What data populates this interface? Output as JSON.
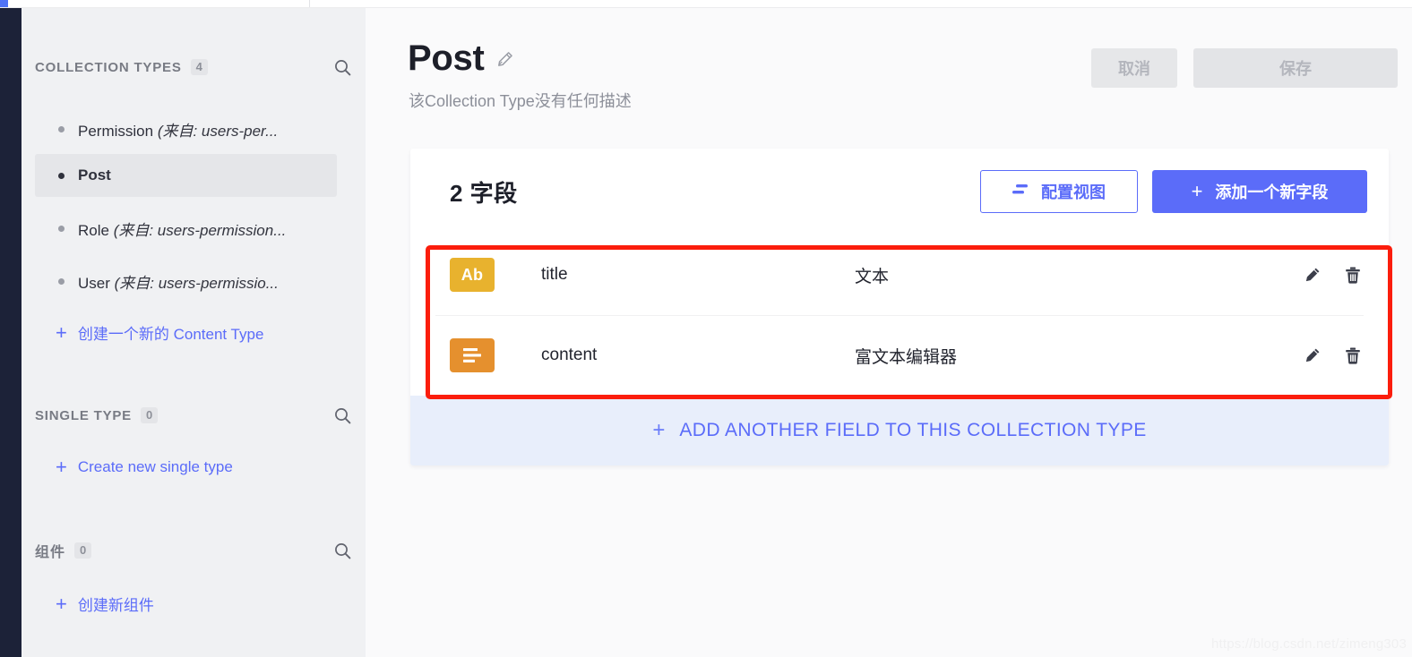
{
  "theme": {
    "accent": "#5b6cf9",
    "rail": "#1c2238",
    "sidebar_bg": "#f0f1f3",
    "main_bg": "#fafafb",
    "card_bg": "#ffffff",
    "footer_bg": "#e8eefb",
    "annotation": "#fb1d0c",
    "text_icon": "#e8b22e",
    "richtext_icon": "#e5902e"
  },
  "sidebar": {
    "sections": [
      {
        "title": "COLLECTION TYPES",
        "count": "4",
        "search_icon": "search-icon",
        "items": [
          {
            "label": "Permission ",
            "suffix": "(来自: users-per...",
            "active": false
          },
          {
            "label": "Post",
            "suffix": "",
            "active": true
          },
          {
            "label": "Role ",
            "suffix": "(来自: users-permission...",
            "active": false
          },
          {
            "label": "User ",
            "suffix": "(来自: users-permissio...",
            "active": false
          }
        ],
        "action": {
          "plus": "+",
          "label": "创建一个新的 Content Type"
        }
      },
      {
        "title": "SINGLE TYPE",
        "count": "0",
        "search_icon": "search-icon",
        "items": [],
        "action": {
          "plus": "+",
          "label": "Create new single type"
        }
      },
      {
        "title": "组件",
        "count": "0",
        "search_icon": "search-icon",
        "items": [],
        "action": {
          "plus": "+",
          "label": "创建新组件"
        }
      }
    ]
  },
  "header": {
    "title": "Post",
    "edit_icon": "pencil-icon",
    "subtitle": "该Collection Type没有任何描述",
    "cancel_label": "取消",
    "save_label": "保存"
  },
  "card": {
    "title": "2 字段",
    "configure_view": {
      "icon": "layout-lines-icon",
      "label": "配置视图"
    },
    "add_field": {
      "plus": "+",
      "label": "添加一个新字段"
    },
    "columns": {
      "name": "",
      "type": ""
    },
    "fields": [
      {
        "icon_label": "Ab",
        "icon_name": "text-field-icon",
        "name": "title",
        "type": "文本",
        "edit_icon": "pencil-icon",
        "delete_icon": "trash-icon"
      },
      {
        "icon_label": "",
        "icon_name": "richtext-field-icon",
        "name": "content",
        "type": "富文本编辑器",
        "edit_icon": "pencil-icon",
        "delete_icon": "trash-icon"
      }
    ],
    "footer": {
      "plus": "+",
      "label": "ADD ANOTHER FIELD TO THIS COLLECTION TYPE"
    }
  },
  "watermark": "https://blog.csdn.net/zimeng303"
}
